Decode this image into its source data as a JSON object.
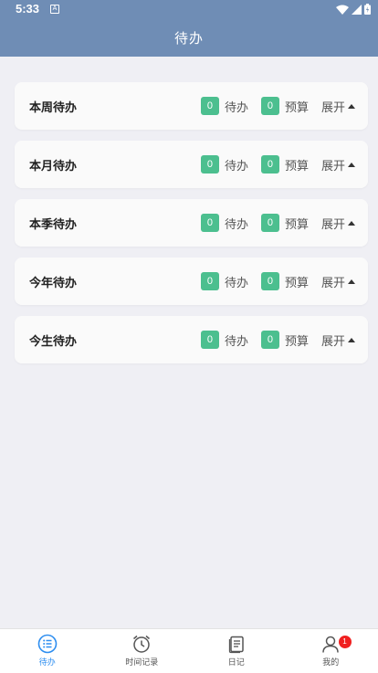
{
  "status_bar": {
    "time": "5:33",
    "app_indicator": "A",
    "icons": [
      "wifi-icon",
      "signal-icon",
      "battery-icon"
    ]
  },
  "header": {
    "title": "待办"
  },
  "colors": {
    "header_bg": "#6f8db5",
    "badge_green": "#4cbf8f",
    "active_tab": "#2e8ef0",
    "notice_red": "#f02020"
  },
  "cards": [
    {
      "title": "本周待办",
      "todo_count": "0",
      "todo_label": "待办",
      "budget_count": "0",
      "budget_label": "预算",
      "expand_label": "展开"
    },
    {
      "title": "本月待办",
      "todo_count": "0",
      "todo_label": "待办",
      "budget_count": "0",
      "budget_label": "预算",
      "expand_label": "展开"
    },
    {
      "title": "本季待办",
      "todo_count": "0",
      "todo_label": "待办",
      "budget_count": "0",
      "budget_label": "预算",
      "expand_label": "展开"
    },
    {
      "title": "今年待办",
      "todo_count": "0",
      "todo_label": "待办",
      "budget_count": "0",
      "budget_label": "预算",
      "expand_label": "展开"
    },
    {
      "title": "今生待办",
      "todo_count": "0",
      "todo_label": "待办",
      "budget_count": "0",
      "budget_label": "预算",
      "expand_label": "展开"
    }
  ],
  "tabs": [
    {
      "label": "待办",
      "icon": "list-icon",
      "active": true
    },
    {
      "label": "时间记录",
      "icon": "alarm-clock-icon",
      "active": false
    },
    {
      "label": "日记",
      "icon": "notebook-icon",
      "active": false
    },
    {
      "label": "我的",
      "icon": "person-icon",
      "active": false,
      "badge": "1"
    }
  ]
}
